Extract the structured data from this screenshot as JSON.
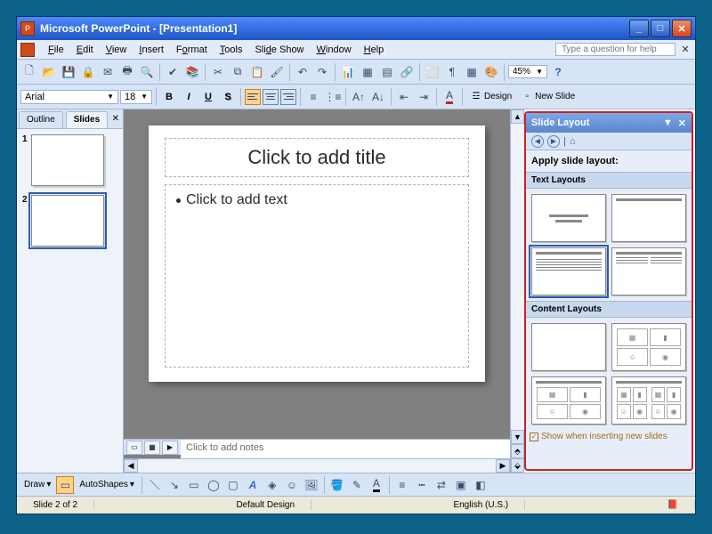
{
  "titlebar": {
    "title": "Microsoft PowerPoint - [Presentation1]"
  },
  "menu": {
    "file": "File",
    "edit": "Edit",
    "view": "View",
    "insert": "Insert",
    "format": "Format",
    "tools": "Tools",
    "slideshow": "Slide Show",
    "window": "Window",
    "help": "Help"
  },
  "helpbox_placeholder": "Type a question for help",
  "zoom": "45%",
  "format_toolbar": {
    "font": "Arial",
    "size": "18",
    "design": "Design",
    "newslide": "New Slide"
  },
  "leftpanel": {
    "tab_outline": "Outline",
    "tab_slides": "Slides",
    "slides": [
      {
        "n": "1"
      },
      {
        "n": "2"
      }
    ],
    "selected": 2
  },
  "slide": {
    "title_ph": "Click to add title",
    "text_ph": "Click to add text"
  },
  "notes_ph": "Click to add notes",
  "taskpane": {
    "title": "Slide Layout",
    "apply_label": "Apply slide layout:",
    "section_text": "Text Layouts",
    "section_content": "Content Layouts",
    "show_label": "Show when inserting new slides"
  },
  "draw": {
    "draw": "Draw",
    "autoshapes": "AutoShapes"
  },
  "status": {
    "slide": "Slide 2 of 2",
    "design": "Default Design",
    "lang": "English (U.S.)"
  }
}
